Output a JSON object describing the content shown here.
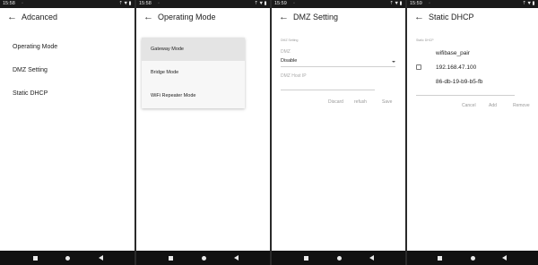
{
  "screens": [
    {
      "status": {
        "time": "15:58",
        "notif": "◦",
        "icons": "⇡▼▮"
      },
      "title": "Adcanced",
      "menu": [
        "Operating Mode",
        "DMZ Setting",
        "Static DHCP"
      ]
    },
    {
      "status": {
        "time": "15:58",
        "notif": "◦",
        "icons": "⇡▼▮"
      },
      "title": "Operating Mode",
      "options": [
        "Gateway Mode",
        "Bridge Mode",
        "WiFi Repeater Mode"
      ],
      "selected_index": 0
    },
    {
      "status": {
        "time": "15:59",
        "notif": "◦",
        "icons": "⇡▼▮"
      },
      "title": "DMZ Setting",
      "section_label": "DMZ Setting",
      "dmz_label": "DMZ",
      "dmz_value": "Disable",
      "host_ip_placeholder": "DMZ Host IP",
      "buttons": [
        "Discard",
        "refush",
        "Save"
      ]
    },
    {
      "status": {
        "time": "15:59",
        "notif": "◦",
        "icons": "⇡▼▮"
      },
      "title": "Static DHCP",
      "section_label": "Static DHCP",
      "device_name": "wifibase_pair",
      "ip": "192.168.47.100",
      "mac": "86-db-19-b9-b5-fb",
      "buttons": [
        "Cancel",
        "Add",
        "Remove"
      ]
    }
  ],
  "nav": {
    "back_icon": "arrow-left",
    "square": "recents",
    "circle": "home",
    "triangle": "back"
  }
}
